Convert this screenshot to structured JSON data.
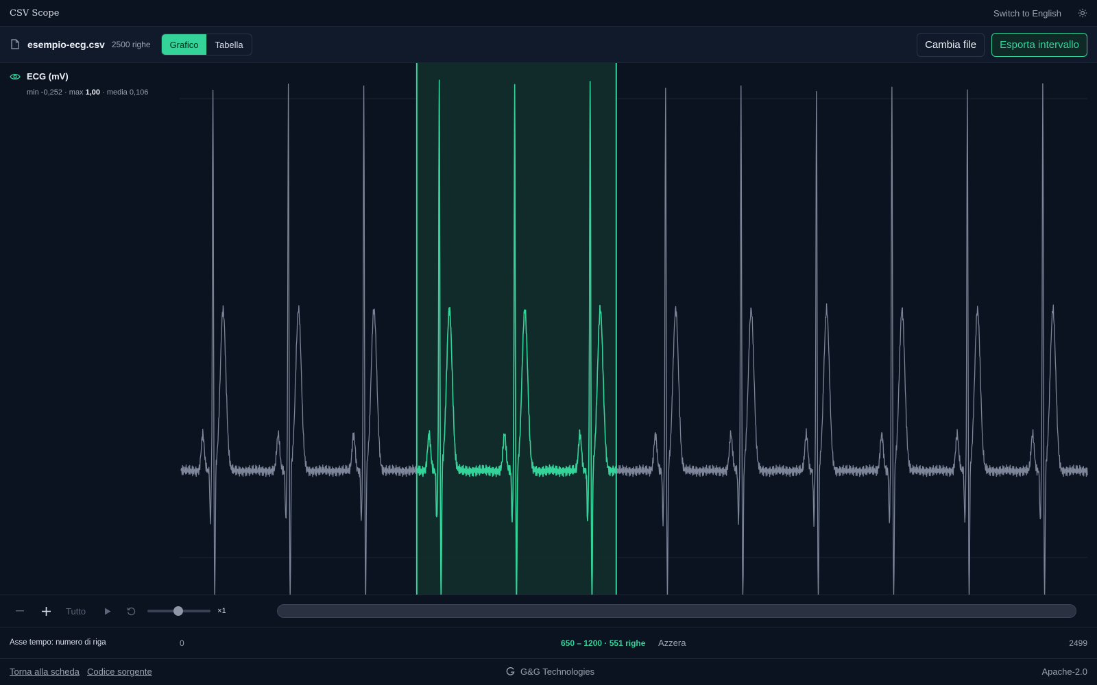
{
  "header": {
    "app_title": "CSV Scope",
    "language_link": "Switch to English"
  },
  "file": {
    "name": "esempio-ecg.csv",
    "rows": "2500 righe",
    "tabs": [
      {
        "label": "Grafico",
        "active": true
      },
      {
        "label": "Tabella",
        "active": false
      }
    ],
    "change_button": "Cambia file",
    "export_button": "Esporta intervallo"
  },
  "series": {
    "name": "ECG (mV)",
    "stat_min_label": "min",
    "stat_min": "-0,252",
    "stat_max_label": "max",
    "stat_max": "1,00",
    "stat_mean_label": "media",
    "stat_mean": "0,106"
  },
  "controls": {
    "all_label": "Tutto",
    "speed_label": "×1"
  },
  "axis": {
    "label": "Asse tempo: numero di riga",
    "start": "0",
    "selection": "650 – 1200 · 551 righe",
    "reset_label": "Azzera",
    "end": "2499"
  },
  "footer": {
    "back_link": "Torna alla scheda",
    "source_link": "Codice sorgente",
    "brand": "G&G Technologies",
    "license": "Apache-2.0"
  },
  "chart_data": {
    "type": "line",
    "series": [
      {
        "name": "ECG (mV)",
        "beat_count": 12
      }
    ],
    "x_range": [
      0,
      2499
    ],
    "y_range": [
      -0.252,
      1.0
    ],
    "selection": [
      650,
      1200
    ],
    "beat_rows": [
      88,
      296,
      504,
      712,
      920,
      1128,
      1336,
      1544,
      1752,
      1960,
      2168,
      2376
    ],
    "colors": {
      "line": "#7d8699",
      "selected": "#34d399",
      "selection_fill": "#12302c",
      "grid": "#1c2535"
    }
  }
}
